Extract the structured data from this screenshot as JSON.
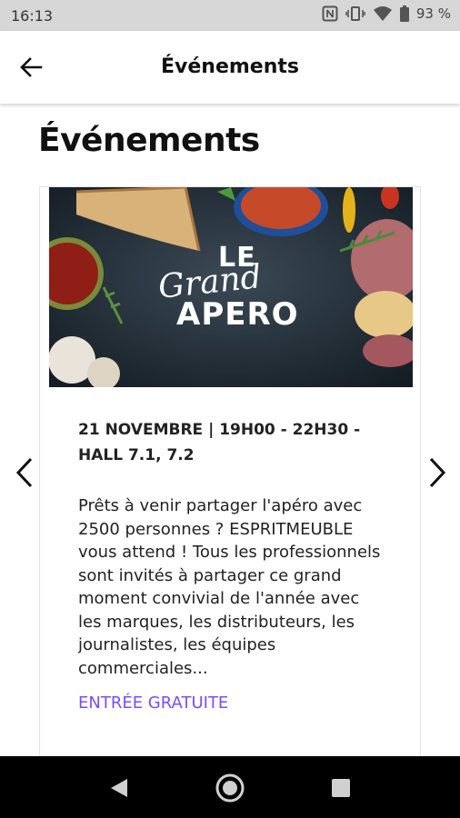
{
  "status_bar": {
    "time": "16:13",
    "battery": "93 %",
    "icons": [
      "nfc-icon",
      "vibrate-icon",
      "wifi-icon",
      "battery-icon"
    ]
  },
  "app_bar": {
    "title": "Événements",
    "back_icon": "arrow-left-icon"
  },
  "page": {
    "heading": "Événements"
  },
  "event_card": {
    "image_logo": {
      "line1": "LE",
      "line2": "Grand",
      "line3": "APERO"
    },
    "meta": "21 NOVEMBRE | 19H00 - 22H30 - HALL 7.1, 7.2",
    "description": "Prêts à venir partager l'apéro avec 2500 personnes ? ESPRITMEUBLE vous attend ! Tous les professionnels sont invités à partager ce grand moment convivial de l'année avec les marques, les distributeurs, les journalistes, les équipes commerciales...",
    "link_label": "ENTRÉE GRATUITE"
  },
  "carousel": {
    "prev_icon": "chevron-left-icon",
    "next_icon": "chevron-right-icon"
  },
  "nav_bar": {
    "icons": [
      "back-triangle-icon",
      "home-circle-icon",
      "recents-square-icon"
    ]
  },
  "colors": {
    "link": "#7a4dff",
    "status_bar": "#d7d7d7",
    "nav_bar": "#000000"
  }
}
